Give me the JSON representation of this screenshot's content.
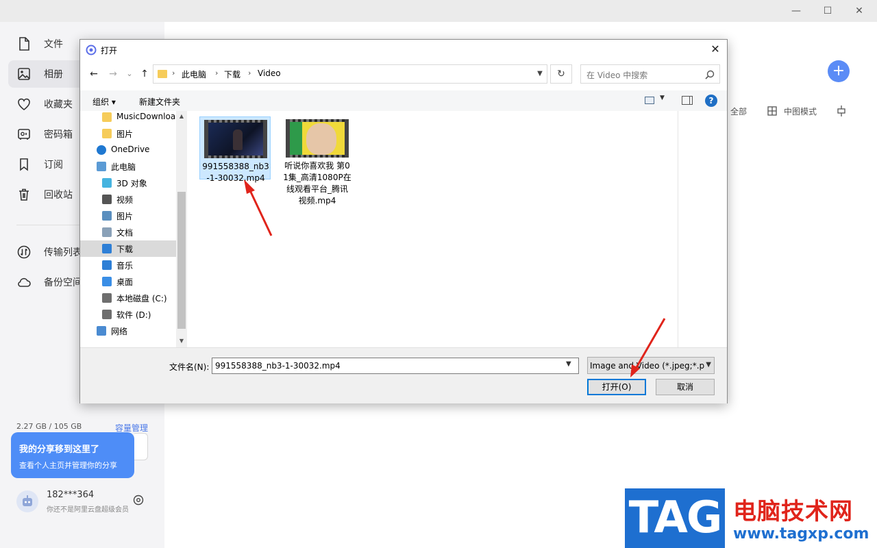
{
  "app": {
    "window_controls": {
      "minimize": "—",
      "maximize": "☐",
      "close": "✕"
    },
    "sidebar": {
      "items": [
        {
          "label": "文件",
          "icon": "file-icon",
          "active": false
        },
        {
          "label": "相册",
          "icon": "photo-album-icon",
          "active": true
        },
        {
          "label": "收藏夹",
          "icon": "heart-icon",
          "active": false
        },
        {
          "label": "密码箱",
          "icon": "safe-icon",
          "active": false
        },
        {
          "label": "订阅",
          "icon": "bookmark-icon",
          "active": false
        },
        {
          "label": "回收站",
          "icon": "trash-icon",
          "active": false
        }
      ],
      "secondary_items": [
        {
          "label": "传输列表",
          "icon": "transfer-icon"
        },
        {
          "label": "备份空间",
          "icon": "cloud-icon"
        }
      ],
      "storage": {
        "text": "2.27 GB / 105 GB",
        "link": "容量管理",
        "used_fraction": 0.022
      },
      "share_tip": {
        "title": "我的分享移到这里了",
        "subtitle": "查看个人主页并管理你的分享"
      },
      "user": {
        "name": "182***364",
        "vip_text": "你还不是阿里云盘超级会员"
      }
    },
    "main": {
      "add_button": "+",
      "toolbar": {
        "all": "全部",
        "map_mode": "中图模式"
      }
    }
  },
  "dialog": {
    "title": "打开",
    "close": "✕",
    "nav": {
      "back": "←",
      "forward": "→",
      "recent": "⌄",
      "up": "↑",
      "refresh": "↻"
    },
    "breadcrumb": [
      "此电脑",
      "下载",
      "Video"
    ],
    "search_placeholder": "在 Video 中搜索",
    "commands": {
      "organize": "组织 ▾",
      "new_folder": "新建文件夹"
    },
    "tree": [
      {
        "label": "MusicDownloa",
        "icon": "folder-icon",
        "indent": 2
      },
      {
        "label": "图片",
        "icon": "folder-icon",
        "indent": 2
      },
      {
        "label": "OneDrive",
        "icon": "onedrive-icon",
        "indent": 1
      },
      {
        "label": "此电脑",
        "icon": "pc-icon",
        "indent": 1
      },
      {
        "label": "3D 对象",
        "icon": "3d-objects-icon",
        "indent": 2
      },
      {
        "label": "视频",
        "icon": "videos-icon",
        "indent": 2
      },
      {
        "label": "图片",
        "icon": "pictures-icon",
        "indent": 2
      },
      {
        "label": "文档",
        "icon": "documents-icon",
        "indent": 2
      },
      {
        "label": "下载",
        "icon": "downloads-icon",
        "indent": 2,
        "selected": true
      },
      {
        "label": "音乐",
        "icon": "music-icon",
        "indent": 2
      },
      {
        "label": "桌面",
        "icon": "desktop-icon",
        "indent": 2
      },
      {
        "label": "本地磁盘 (C:)",
        "icon": "drive-icon",
        "indent": 2
      },
      {
        "label": "软件 (D:)",
        "icon": "drive-icon",
        "indent": 2
      },
      {
        "label": "网络",
        "icon": "network-icon",
        "indent": 1
      }
    ],
    "files": [
      {
        "name": "991558388_nb3-1-30032.mp4",
        "selected": true
      },
      {
        "name": "听说你喜欢我 第01集_高清1080P在线观看平台_腾讯视频.mp4",
        "selected": false
      }
    ],
    "filename_label": "文件名(N):",
    "filename_value": "991558388_nb3-1-30032.mp4",
    "filter_value": "Image and Video (*.jpeg;*.pn",
    "open_button": "打开(O)",
    "cancel_button": "取消"
  },
  "watermark": {
    "tag": "TAG",
    "site_name": "电脑技术网",
    "url": "www.tagxp.com"
  },
  "colors": {
    "accent": "#4a78e8",
    "dialog_focus": "#0078d7",
    "annotation": "#e0241b"
  }
}
